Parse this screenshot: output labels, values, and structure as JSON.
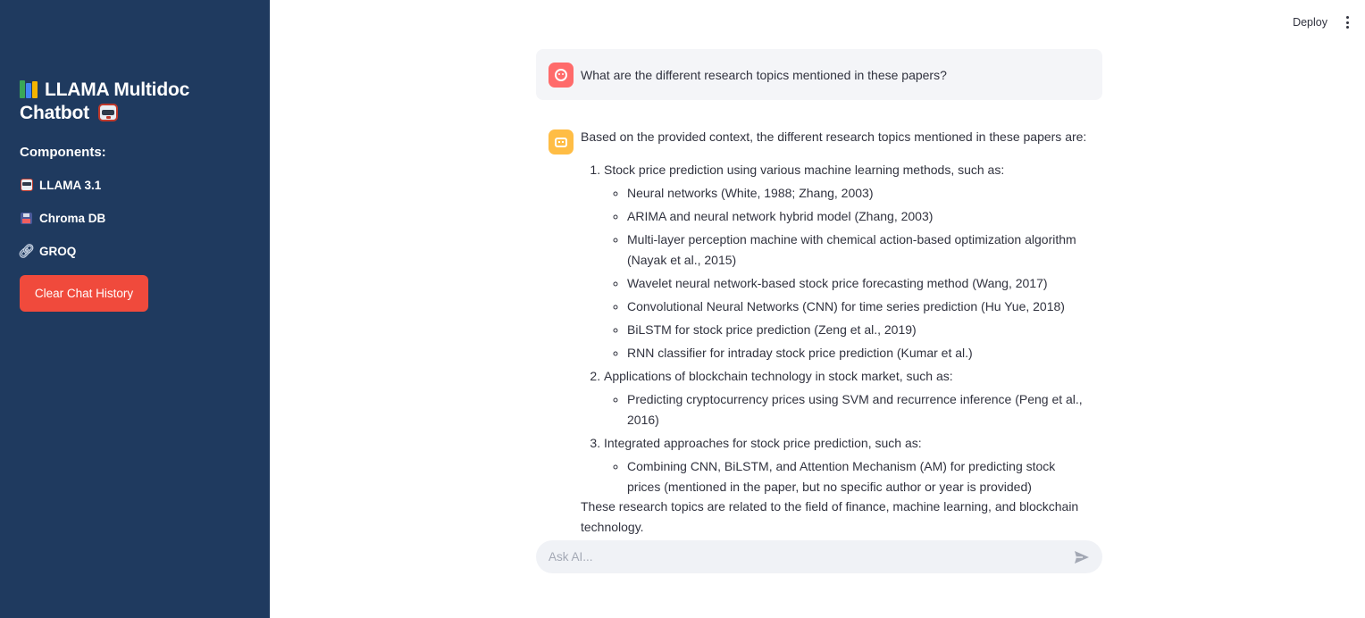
{
  "sidebar": {
    "title": "LLAMA Multidoc Chatbot",
    "components_heading": "Components:",
    "items": [
      {
        "icon": "robot-icon",
        "label": "LLAMA 3.1"
      },
      {
        "icon": "floppy-disk-icon",
        "label": "Chroma DB"
      },
      {
        "icon": "link-icon",
        "label": "GROQ"
      }
    ],
    "clear_button_label": "Clear Chat History",
    "background_color": "#1f3a5f",
    "button_color": "#f04a3c"
  },
  "header": {
    "deploy_label": "Deploy"
  },
  "chat": {
    "user_message": "What are the different research topics mentioned in these papers?",
    "assistant": {
      "intro": "Based on the provided context, the different research topics mentioned in these papers are:",
      "topics": [
        {
          "title": "Stock price prediction using various machine learning methods, such as:",
          "items": [
            "Neural networks (White, 1988; Zhang, 2003)",
            "ARIMA and neural network hybrid model (Zhang, 2003)",
            "Multi-layer perception machine with chemical action-based optimization algorithm (Nayak et al., 2015)",
            "Wavelet neural network-based stock price forecasting method (Wang, 2017)",
            "Convolutional Neural Networks (CNN) for time series prediction (Hu Yue, 2018)",
            "BiLSTM for stock price prediction (Zeng et al., 2019)",
            "RNN classifier for intraday stock price prediction (Kumar et al.)"
          ]
        },
        {
          "title": "Applications of blockchain technology in stock market, such as:",
          "items": [
            "Predicting cryptocurrency prices using SVM and recurrence inference (Peng et al., 2016)"
          ]
        },
        {
          "title": "Integrated approaches for stock price prediction, such as:",
          "items": [
            "Combining CNN, BiLSTM, and Attention Mechanism (AM) for predicting stock prices (mentioned in the paper, but no specific author or year is provided)"
          ]
        }
      ],
      "closing": "These research topics are related to the field of finance, machine learning, and blockchain technology."
    },
    "input_placeholder": "Ask AI...",
    "user_avatar_color": "#ff6b6b",
    "assistant_avatar_color": "#ffbd45"
  }
}
